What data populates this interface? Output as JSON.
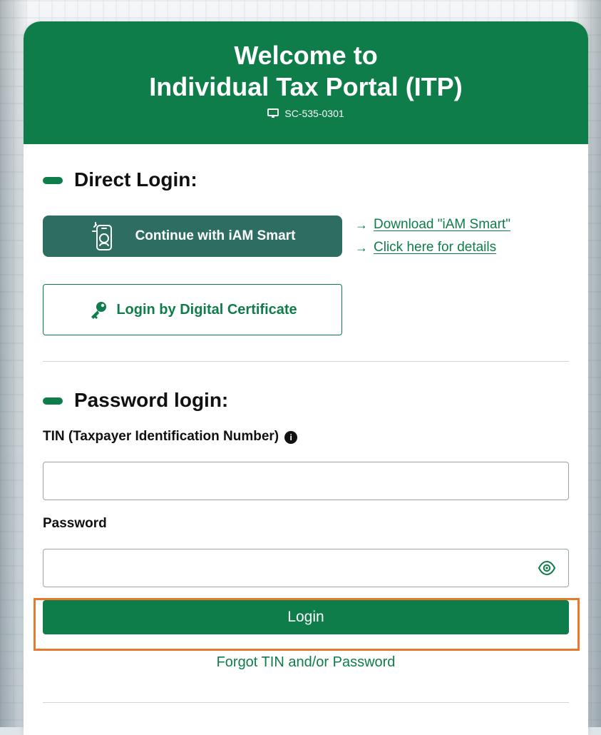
{
  "header": {
    "title_line1": "Welcome to",
    "title_line2": "Individual Tax Portal (ITP)",
    "code": "SC-535-0301",
    "code_icon": "monitor-icon"
  },
  "direct_login": {
    "title": "Direct Login:",
    "iam_button_label": "Continue with iAM Smart",
    "iam_icon": "iam-smart-icon",
    "links": [
      {
        "label": "Download \"iAM Smart\"",
        "arrow": "→"
      },
      {
        "label": "Click here for details",
        "arrow": "→"
      }
    ],
    "cert_button_label": "Login by Digital Certificate",
    "cert_icon": "key-icon"
  },
  "password_login": {
    "title": "Password login:",
    "tin_label": "TIN (Taxpayer Identification Number)",
    "tin_info_icon": "info-icon",
    "tin_value": "",
    "password_label": "Password",
    "password_value": "",
    "password_toggle_icon": "eye-icon",
    "login_button_label": "Login",
    "forgot_label": "Forgot TIN and/or Password"
  },
  "colors": {
    "primary_green": "#0f7d4a",
    "iam_teal": "#2e6e62",
    "highlight_orange": "#e57a2e"
  }
}
